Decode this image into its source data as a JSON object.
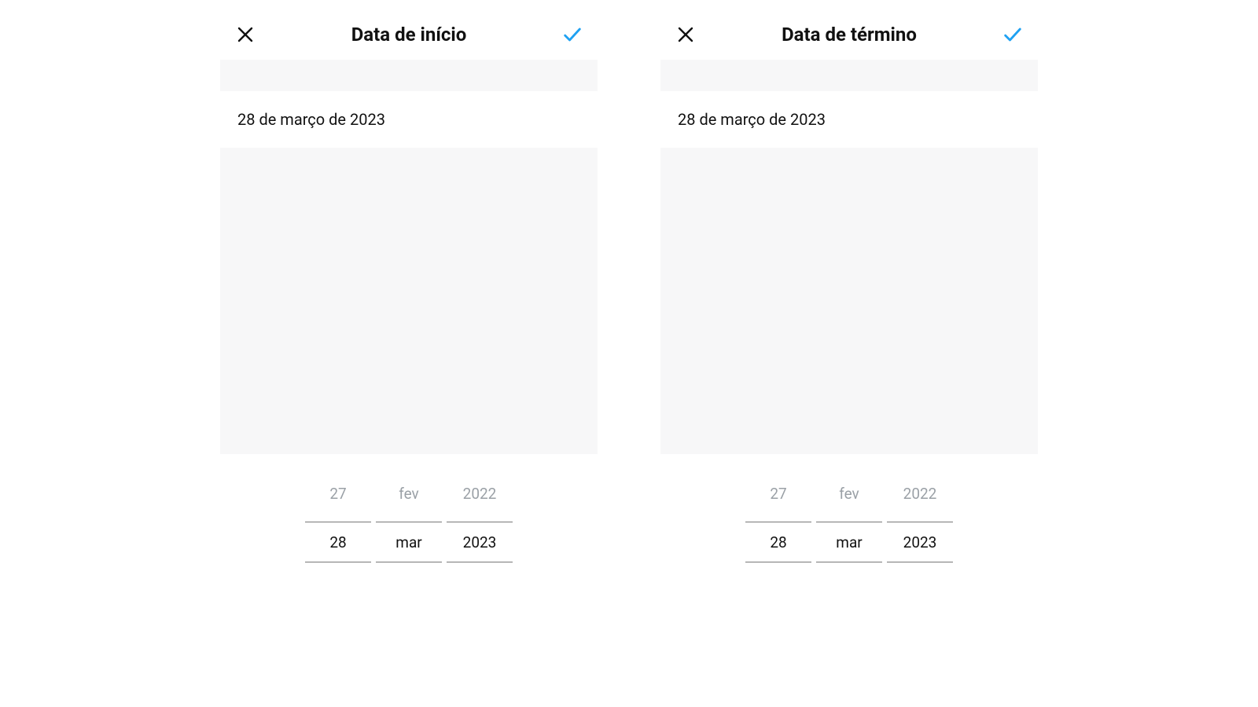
{
  "colors": {
    "accent": "#1ea1f2",
    "muted": "#9aa0a6",
    "line": "#777"
  },
  "panels": [
    {
      "title": "Data de início",
      "selected_date_label": "28 de março de 2023",
      "picker": {
        "day": {
          "prev": "27",
          "selected": "28"
        },
        "month": {
          "prev": "fev",
          "selected": "mar"
        },
        "year": {
          "prev": "2022",
          "selected": "2023"
        }
      }
    },
    {
      "title": "Data de término",
      "selected_date_label": "28 de março de 2023",
      "picker": {
        "day": {
          "prev": "27",
          "selected": "28"
        },
        "month": {
          "prev": "fev",
          "selected": "mar"
        },
        "year": {
          "prev": "2022",
          "selected": "2023"
        }
      }
    }
  ]
}
